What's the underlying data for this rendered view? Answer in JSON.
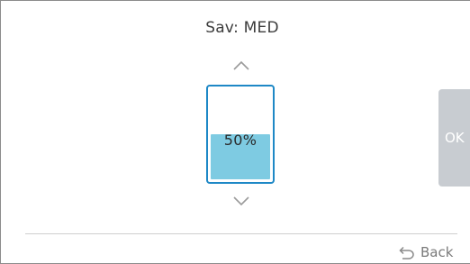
{
  "header": {
    "title": "Sav: MED"
  },
  "level_control": {
    "up_icon": "chevron-up-icon",
    "down_icon": "chevron-down-icon",
    "level_text": "50%",
    "level_fraction": 0.5,
    "outline_color": "#1e88c6",
    "fill_color": "#7ecbe2"
  },
  "actions": {
    "ok_label": "OK",
    "back_label": "Back",
    "back_icon": "back-arrow-icon"
  }
}
